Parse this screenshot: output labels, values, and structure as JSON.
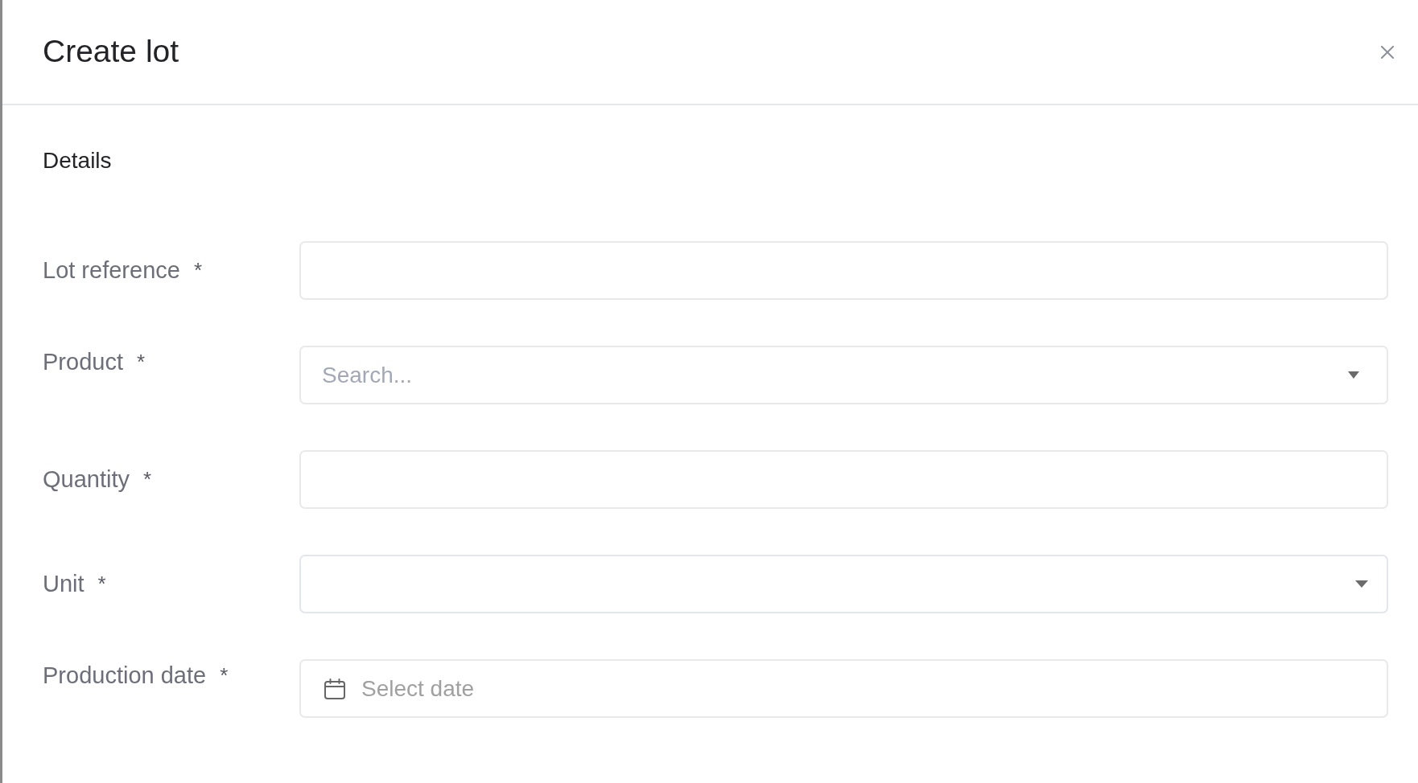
{
  "dialog": {
    "title": "Create lot"
  },
  "section": {
    "title": "Details"
  },
  "fields": [
    {
      "kind": "text",
      "label": "Lot reference",
      "required_mark": "*"
    },
    {
      "kind": "search-select",
      "label": "Product",
      "required_mark": "*",
      "placeholder": "Search..."
    },
    {
      "kind": "text",
      "label": "Quantity",
      "required_mark": "*"
    },
    {
      "kind": "select",
      "label": "Unit",
      "required_mark": "*"
    },
    {
      "kind": "date",
      "label": "Production date",
      "required_mark": "*",
      "placeholder": "Select date"
    }
  ]
}
